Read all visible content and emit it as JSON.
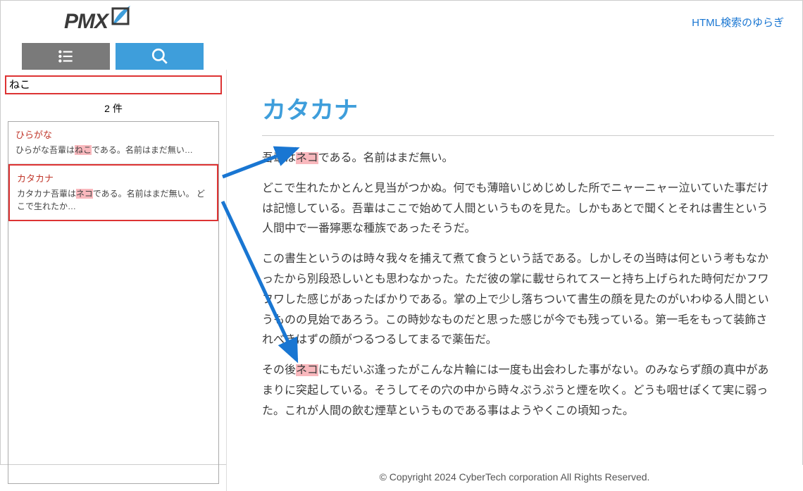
{
  "header": {
    "logo_text": "PMX",
    "link_text": "HTML検索のゆらぎ"
  },
  "search": {
    "value": "ねこ",
    "count": "2 件"
  },
  "results": [
    {
      "title": "ひらがな",
      "snippet_pre": "ひらがな吾輩は",
      "snippet_hl": "ねこ",
      "snippet_post": "である。名前はまだ無い…",
      "active": false
    },
    {
      "title": "カタカナ",
      "snippet_pre": "カタカナ吾輩は",
      "snippet_hl": "ネコ",
      "snippet_post": "である。名前はまだ無い。 どこで生れたか…",
      "active": true
    }
  ],
  "content": {
    "title": "カタカナ",
    "p1_pre": "吾輩は",
    "p1_hl": "ネコ",
    "p1_post": "である。名前はまだ無い。",
    "p2_pre": "どこで生れたかとんと見当がつかぬ。何でも薄暗いじめじめした所でニャーニャー泣いていた事だけは記憶している。吾輩はここで始めて人間というものを見た。しかもあとで聞くとそれは書生という人間中で一番獰悪な種族であったそうだ。",
    "p3": "この書生というのは時々我々を捕えて煮て食うという話である。しかしその当時は何という考もなかったから別段恐しいとも思わなかった。ただ彼の掌に載せられてスーと持ち上げられた時何だかフワフワした感じがあったばかりである。掌の上で少し落ちついて書生の顔を見たのがいわゆる人間というものの見始であろう。この時妙なものだと思った感じが今でも残っている。第一毛をもって装飾されべきはずの顔がつるつるしてまるで薬缶だ。",
    "p4_pre": "その後",
    "p4_hl": "ネコ",
    "p4_post": "にもだいぶ逢ったがこんな片輪には一度も出会わした事がない。のみならず顔の真中があまりに突起している。そうしてその穴の中から時々ぷうぷうと煙を吹く。どうも咽せぽくて実に弱った。これが人間の飲む煙草というものである事はようやくこの頃知った。"
  },
  "footer": "© Copyright  2024 CyberTech corporation  All  Rights  Reserved."
}
